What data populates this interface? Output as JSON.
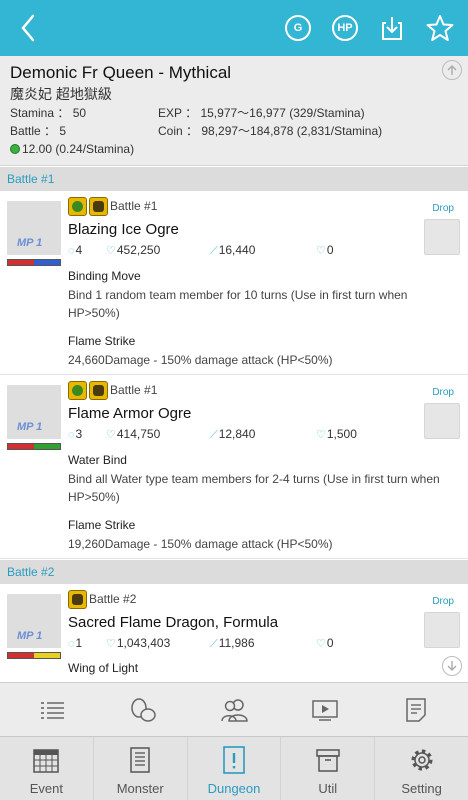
{
  "colors": {
    "accent": "#33b5d4",
    "link": "#2a9cc0",
    "header_bg": "#ececec"
  },
  "topbar": {
    "back_icon": "chevron-left-icon",
    "buttons": [
      {
        "name": "g-button",
        "label": "G"
      },
      {
        "name": "hp-button",
        "label": "HP"
      },
      {
        "name": "download-button",
        "icon": "download-icon"
      },
      {
        "name": "favorite-button",
        "icon": "star-icon"
      }
    ]
  },
  "dungeon": {
    "title": "Demonic Fr Queen - Mythical",
    "subtitle": "魔炎妃 超地獄級",
    "stamina": "Stamina ： 50",
    "battles": "Battle ： 5",
    "exp": "EXP ： 15,977～16,977 (329/Stamina)",
    "coin": "Coin ： 98,297～184,878 (2,831/Stamina)",
    "gem": "12.00 (0.24/Stamina)"
  },
  "sections": [
    {
      "header": "Battle #1",
      "monsters": [
        {
          "battle_tag": "Battle #1",
          "name": "Blazing Ice Ogre",
          "mp": "MP 1",
          "drop_label": "Drop",
          "turns": "4",
          "hp": "452,250",
          "atk": "16,440",
          "def": "0",
          "hp_colors": [
            "#d03030",
            "#3060d0"
          ],
          "skills": [
            {
              "name": "Binding Move",
              "desc": "Bind 1 random team member for 10 turns (Use in first turn when HP>50%)"
            },
            {
              "name": "Flame Strike",
              "desc": "24,660Damage - 150% damage attack (HP<50%)"
            }
          ]
        },
        {
          "battle_tag": "Battle #1",
          "name": "Flame Armor Ogre",
          "mp": "MP 1",
          "drop_label": "Drop",
          "turns": "3",
          "hp": "414,750",
          "atk": "12,840",
          "def": "1,500",
          "hp_colors": [
            "#d03030",
            "#30a030"
          ],
          "skills": [
            {
              "name": "Water Bind",
              "desc": "Bind all Water type team members for 2-4 turns (Use in first turn when HP>50%)"
            },
            {
              "name": "Flame Strike",
              "desc": "19,260Damage - 150% damage attack (HP<50%)"
            }
          ]
        }
      ]
    },
    {
      "header": "Battle #2",
      "monsters": [
        {
          "battle_tag": "Battle #2",
          "name": "Sacred Flame Dragon, Formula",
          "mp": "MP 1",
          "drop_label": "Drop",
          "turns": "1",
          "hp": "1,043,403",
          "atk": "11,986",
          "def": "0",
          "hp_colors": [
            "#d03030",
            "#e8d020"
          ],
          "skills": [
            {
              "name": "Wing of Light",
              "desc": ""
            }
          ]
        }
      ]
    }
  ],
  "toolbar": [
    {
      "name": "list-icon"
    },
    {
      "name": "eggs-icon"
    },
    {
      "name": "team-icon"
    },
    {
      "name": "video-icon"
    },
    {
      "name": "notes-icon"
    }
  ],
  "nav": [
    {
      "label": "Event",
      "icon": "calendar-icon"
    },
    {
      "label": "Monster",
      "icon": "monster-list-icon"
    },
    {
      "label": "Dungeon",
      "icon": "dungeon-icon",
      "active": true
    },
    {
      "label": "Util",
      "icon": "box-icon"
    },
    {
      "label": "Setting",
      "icon": "gear-icon"
    }
  ]
}
